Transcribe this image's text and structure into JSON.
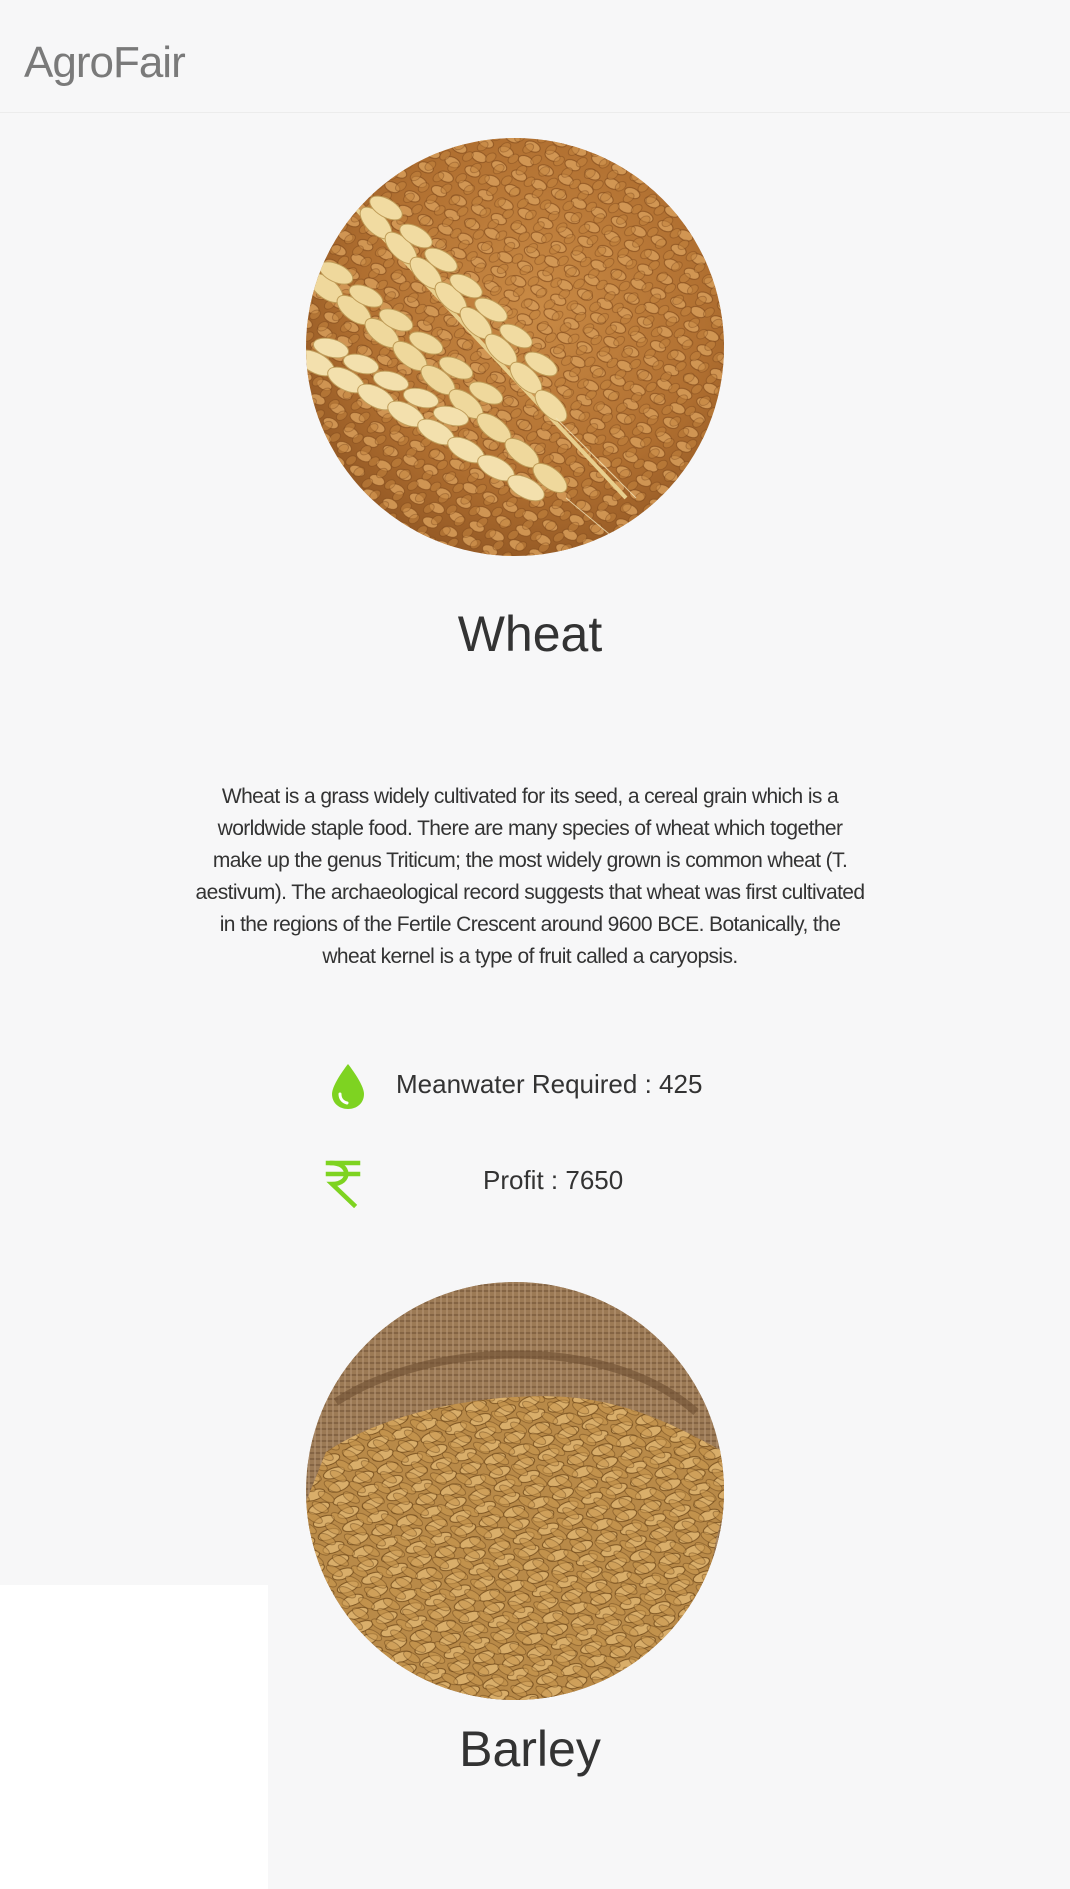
{
  "navbar": {
    "brand": "AgroFair"
  },
  "crops": [
    {
      "name": "Wheat",
      "image_alt": "wheat-grains-and-ears",
      "description": "Wheat is a grass widely cultivated for its seed, a cereal grain which is a worldwide staple food. There are many species of wheat which together make up the genus Triticum; the most widely grown is common wheat (T. aestivum). The archaeological record suggests that wheat was first cultivated in the regions of the Fertile Crescent around 9600 BCE. Botanically, the wheat kernel is a type of fruit called a caryopsis.",
      "stats": {
        "water_label": "Meanwater Required : 425",
        "profit_label": "Profit : 7650"
      }
    },
    {
      "name": "Barley",
      "image_alt": "barley-grains-in-sack"
    }
  ],
  "icons": {
    "water": "water-drop-icon",
    "profit": "rupee-icon"
  },
  "colors": {
    "accent": "#7ed321",
    "text": "#333333",
    "brand": "#7a7a7a",
    "background": "#f7f7f8"
  }
}
